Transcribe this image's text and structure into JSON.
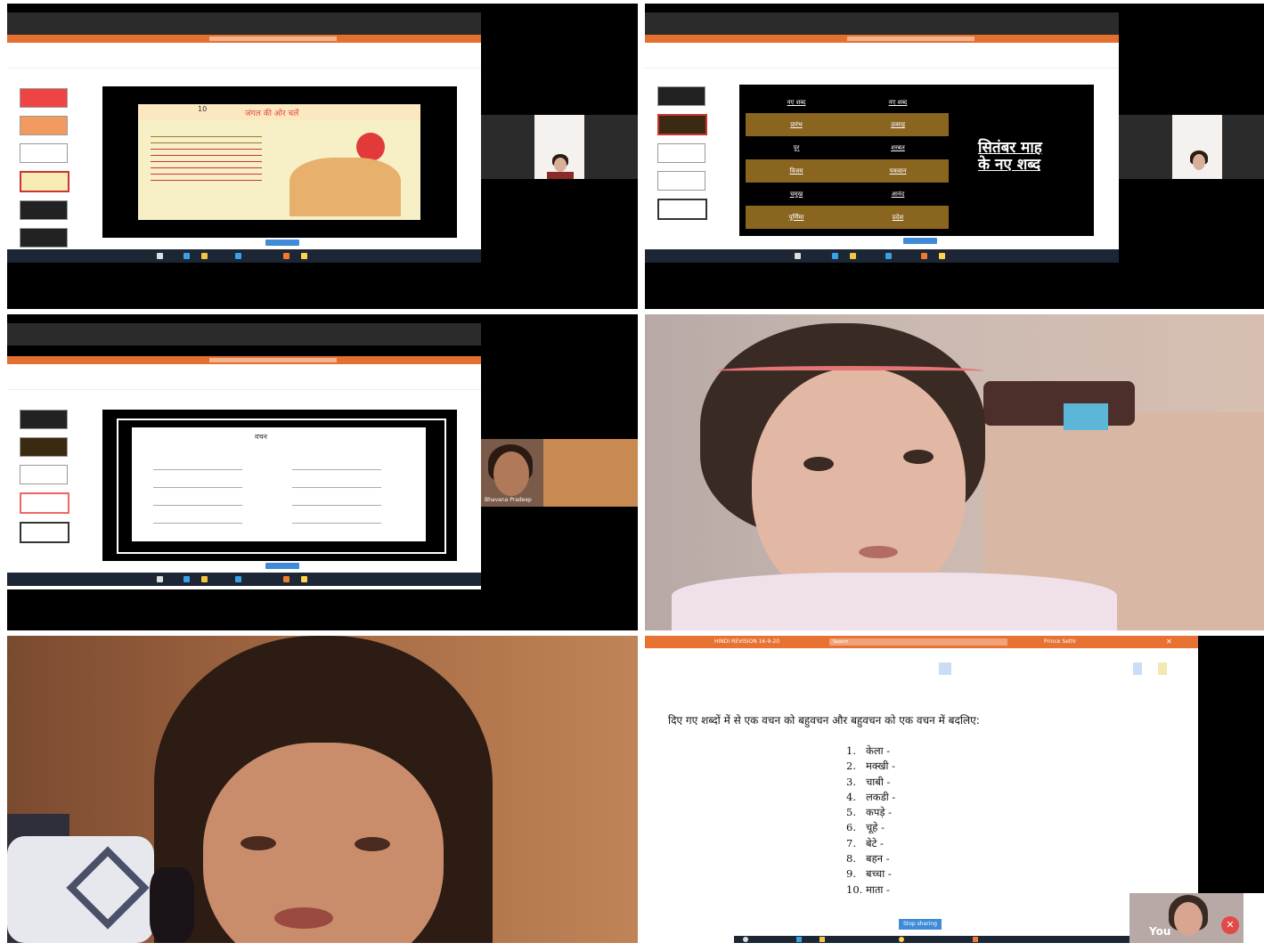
{
  "tiles": {
    "t1": {
      "page_number": "10",
      "slide_heading": "जंगल की ओर चलें"
    },
    "t2": {
      "table_headers": [
        "नए शब्द",
        "नए शब्द"
      ],
      "rows": [
        [
          "प्रारंभ",
          "उत्साह"
        ],
        [
          "पुर",
          "शरबत"
        ],
        [
          "विजय",
          "पकवान"
        ],
        [
          "चमुख",
          "आनंद"
        ],
        [
          "पूर्णिमा",
          "प्रदेश"
        ]
      ],
      "slide_title_line1": "सितंबर माह",
      "slide_title_line2": "के नए शब्द"
    },
    "t3": {
      "worksheet_title": "वचन",
      "participant_name": "Bhavana Pradeep"
    },
    "t6": {
      "doc_title": "HINDI REVISION 16-9-20",
      "search_placeholder": "Search",
      "user_name": "Prince Sethi",
      "instruction": "दिए गए शब्दों में से एक वचन को बहुवचन और बहुवचन को एक वचन में बदलिए:",
      "words": [
        {
          "num": "1.",
          "word": "केला -"
        },
        {
          "num": "2.",
          "word": "मक्खी -"
        },
        {
          "num": "3.",
          "word": "चाबी -"
        },
        {
          "num": "4.",
          "word": "लकडी -"
        },
        {
          "num": "5.",
          "word": "कपड़े -"
        },
        {
          "num": "6.",
          "word": "चूहे -"
        },
        {
          "num": "7.",
          "word": "बेटे -"
        },
        {
          "num": "8.",
          "word": "बहन -"
        },
        {
          "num": "9.",
          "word": "बच्चा -"
        },
        {
          "num": "10.",
          "word": "माता -"
        }
      ],
      "stop_sharing": "Stop sharing",
      "you_label": "You",
      "date": "16-09-2020"
    }
  }
}
